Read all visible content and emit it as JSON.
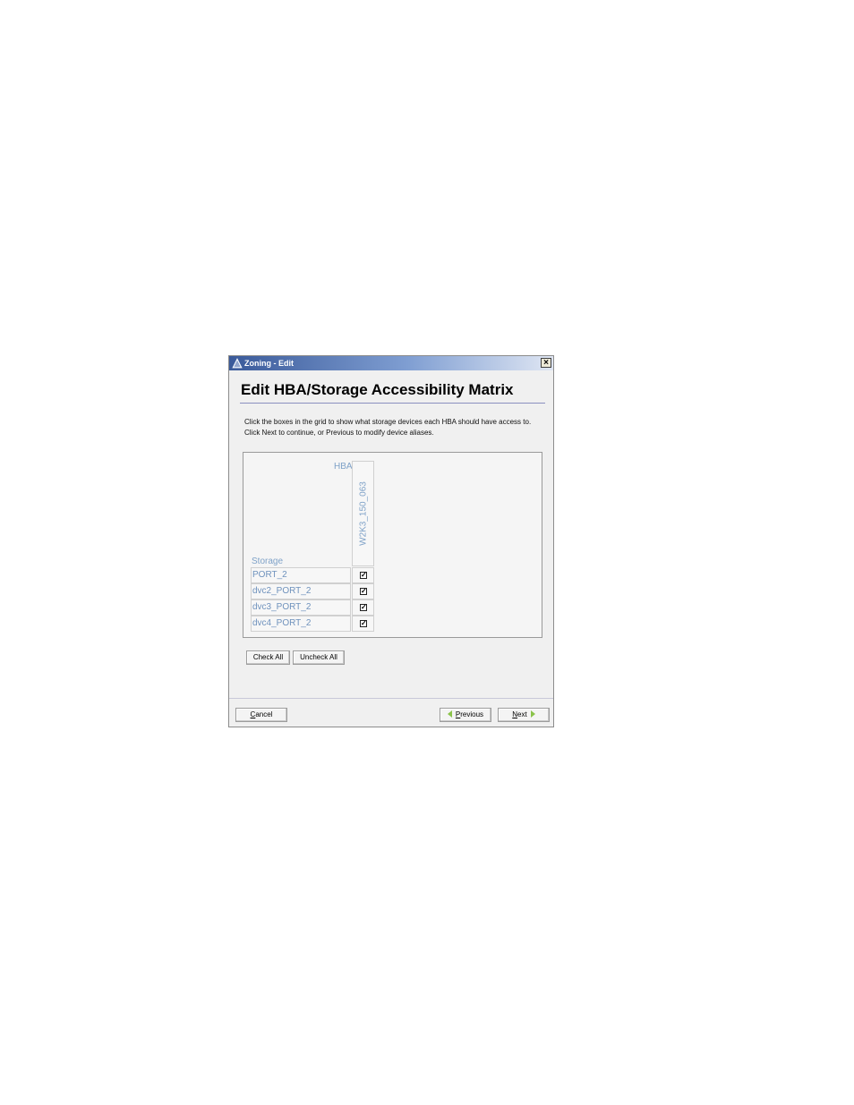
{
  "window": {
    "title": "Zoning - Edit",
    "close_symbol": "×"
  },
  "page": {
    "heading": "Edit HBA/Storage Accessibility Matrix",
    "instructions": [
      "Click the boxes in the grid to show what storage devices each HBA should have access to.",
      "Click Next to continue, or Previous to modify device aliases."
    ]
  },
  "matrix": {
    "hba_label": "HBA",
    "storage_label": "Storage",
    "hba_columns": [
      "W2K3_150_063"
    ],
    "rows": [
      {
        "name": "PORT_2",
        "checked": true
      },
      {
        "name": "dvc2_PORT_2",
        "checked": true
      },
      {
        "name": "dvc3_PORT_2",
        "checked": true
      },
      {
        "name": "dvc4_PORT_2",
        "checked": true
      }
    ],
    "check_mark": "✓"
  },
  "buttons": {
    "check_all": "Check All",
    "uncheck_all": "Uncheck All",
    "cancel_mnemonic": "C",
    "cancel_rest": "ancel",
    "previous_mnemonic": "P",
    "previous_rest": "revious",
    "next_mnemonic": "N",
    "next_rest": "ext"
  },
  "colors": {
    "label_blue": "#7fa2c8",
    "nav_arrow": "#8bc34a",
    "title_bar": "#3a5a9a"
  },
  "icons": {
    "window": "zoning-app-icon",
    "close": "close-icon",
    "previous": "arrow-left-icon",
    "next": "arrow-right-icon"
  }
}
